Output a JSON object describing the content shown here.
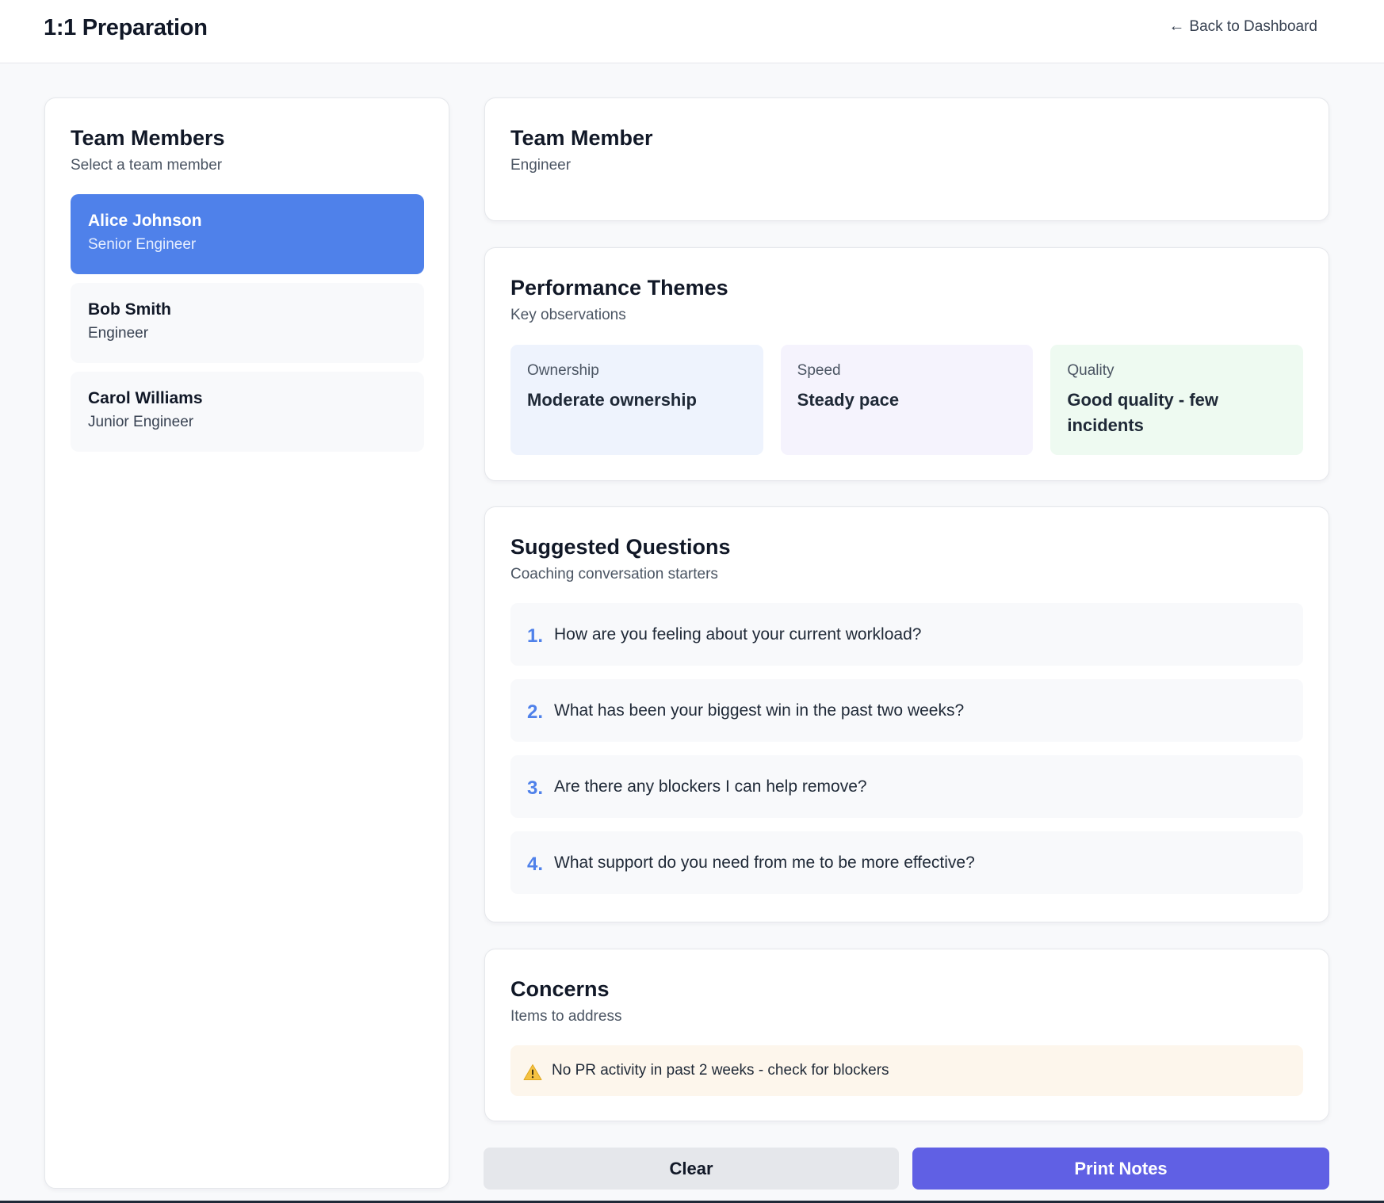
{
  "header": {
    "title": "1:1 Preparation",
    "back_arrow": "←",
    "back_label": "Back to Dashboard"
  },
  "team_panel": {
    "title": "Team Members",
    "subtitle": "Select a team member",
    "members": [
      {
        "name": "Alice Johnson",
        "role": "Senior Engineer",
        "selected": true
      },
      {
        "name": "Bob Smith",
        "role": "Engineer",
        "selected": false
      },
      {
        "name": "Carol Williams",
        "role": "Junior Engineer",
        "selected": false
      }
    ]
  },
  "profile": {
    "name": "Team Member",
    "role": "Engineer"
  },
  "themes": {
    "title": "Performance Themes",
    "subtitle": "Key observations",
    "items": [
      {
        "label": "Ownership",
        "value": "Moderate ownership",
        "color": "#eef3fd"
      },
      {
        "label": "Speed",
        "value": "Steady pace",
        "color": "#f5f3fd"
      },
      {
        "label": "Quality",
        "value": "Good quality - few incidents",
        "color": "#eefaf1"
      }
    ]
  },
  "questions": {
    "title": "Suggested Questions",
    "subtitle": "Coaching conversation starters",
    "items": [
      {
        "number": "1.",
        "text": "How are you feeling about your current workload?"
      },
      {
        "number": "2.",
        "text": "What has been your biggest win in the past two weeks?"
      },
      {
        "number": "3.",
        "text": "Are there any blockers I can help remove?"
      },
      {
        "number": "4.",
        "text": "What support do you need from me to be more effective?"
      }
    ]
  },
  "concerns": {
    "title": "Concerns",
    "subtitle": "Items to address",
    "items": [
      {
        "icon": "warning-icon",
        "text": "No PR activity in past 2 weeks - check for blockers"
      }
    ]
  },
  "actions": {
    "clear_label": "Clear",
    "print_label": "Print Notes"
  },
  "colors": {
    "accent": "#4f81ea",
    "primary_button": "#6060e4",
    "concern_bg": "#fdf6ec"
  }
}
